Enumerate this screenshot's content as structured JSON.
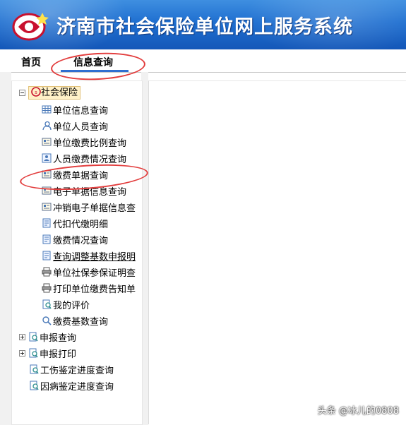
{
  "header": {
    "title": "济南市社会保险单位网上服务系统"
  },
  "nav": {
    "home": "首页",
    "query": "信息查询"
  },
  "tree": {
    "root": "社会保险",
    "items": [
      {
        "label": "单位信息查询",
        "icon": "grid-icon"
      },
      {
        "label": "单位人员查询",
        "icon": "users-icon"
      },
      {
        "label": "单位缴费比例查询",
        "icon": "form-icon"
      },
      {
        "label": "人员缴费情况查询",
        "icon": "person-card-icon"
      },
      {
        "label": "缴费单据查询",
        "icon": "form-icon"
      },
      {
        "label": "电子单据信息查询",
        "icon": "form-icon"
      },
      {
        "label": "冲销电子单据信息查",
        "icon": "form-icon"
      },
      {
        "label": "代扣代缴明细",
        "icon": "doc-icon"
      },
      {
        "label": "缴费情况查询",
        "icon": "doc-icon"
      },
      {
        "label": "查询调整基数申报明",
        "icon": "doc-icon"
      },
      {
        "label": "单位社保参保证明查",
        "icon": "printer-icon"
      },
      {
        "label": "打印单位缴费告知单",
        "icon": "printer-icon"
      },
      {
        "label": "我的评价",
        "icon": "search-doc-icon"
      },
      {
        "label": "缴费基数查询",
        "icon": "search-icon"
      }
    ],
    "groups": [
      {
        "label": "申报查询",
        "icon": "search-doc-icon"
      },
      {
        "label": "申报打印",
        "icon": "search-doc-icon"
      }
    ],
    "tail": [
      {
        "label": "工伤鉴定进度查询",
        "icon": "search-doc-icon"
      },
      {
        "label": "因病鉴定进度查询",
        "icon": "search-doc-icon"
      }
    ]
  },
  "watermark": "头条 @冰儿的0808",
  "colors": {
    "header_top": "#3f8fe0",
    "header_bottom": "#1457b8",
    "annotation": "#e23b3b"
  }
}
